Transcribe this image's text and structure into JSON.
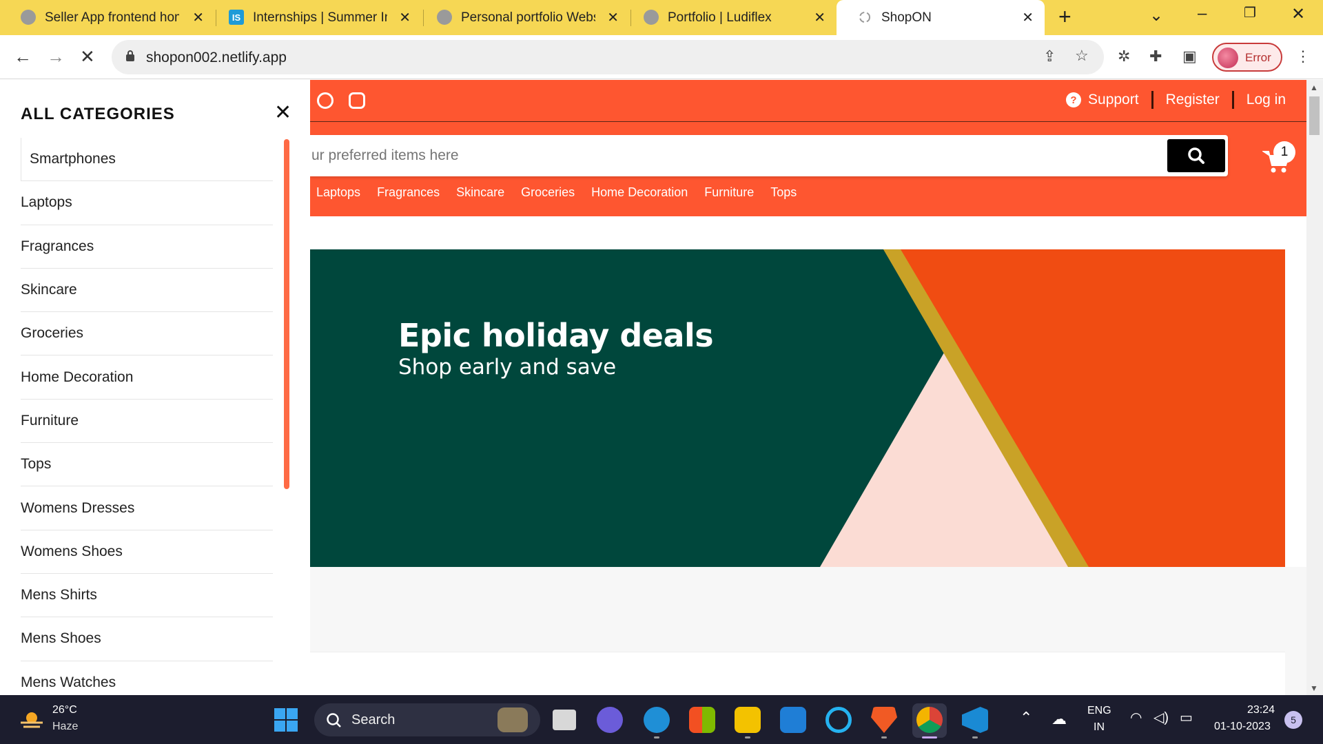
{
  "browser": {
    "tabs": [
      {
        "title": "Seller App frontend home",
        "icon": "globe-icon"
      },
      {
        "title": "Internships | Summer Inte",
        "icon": "internshala-icon",
        "icon_text": "IS"
      },
      {
        "title": "Personal portfolio Websit",
        "icon": "globe-icon"
      },
      {
        "title": "Portfolio | Ludiflex",
        "icon": "globe-icon"
      },
      {
        "title": "ShopON",
        "icon": "spinner-icon",
        "active": true
      }
    ],
    "new_tab_symbol": "+",
    "tab_close_symbol": "✕",
    "url": "shopon002.netlify.app",
    "profile_status": "Error",
    "colors": {
      "tab_strip": "#f6d754",
      "profile_error": "#c83a3a"
    }
  },
  "site": {
    "social": [
      "facebook-icon",
      "instagram-icon"
    ],
    "top_links": {
      "support": "Support",
      "register": "Register",
      "login": "Log in"
    },
    "search_placeholder": "ur preferred items here",
    "cart_count": "1",
    "nav_categories": [
      "Laptops",
      "Fragrances",
      "Skincare",
      "Groceries",
      "Home Decoration",
      "Furniture",
      "Tops"
    ],
    "banner": {
      "title": "Epic holiday deals",
      "subtitle": "Shop early and save"
    },
    "colors": {
      "brand": "#fe5630",
      "banner_green": "#00473c",
      "banner_orange": "#f04c12",
      "banner_pink": "#fbdcd4",
      "banner_gold": "#c9a227"
    }
  },
  "sidebar": {
    "heading": "ALL CATEGORIES",
    "close_symbol": "✕",
    "items": [
      "Smartphones",
      "Laptops",
      "Fragrances",
      "Skincare",
      "Groceries",
      "Home Decoration",
      "Furniture",
      "Tops",
      "Womens Dresses",
      "Womens Shoes",
      "Mens Shirts",
      "Mens Shoes",
      "Mens Watches"
    ]
  },
  "taskbar": {
    "weather": {
      "temp": "26°C",
      "condition": "Haze"
    },
    "search_label": "Search",
    "language": {
      "line1": "ENG",
      "line2": "IN"
    },
    "time": "23:24",
    "date": "01-10-2023",
    "notifications": "5"
  }
}
